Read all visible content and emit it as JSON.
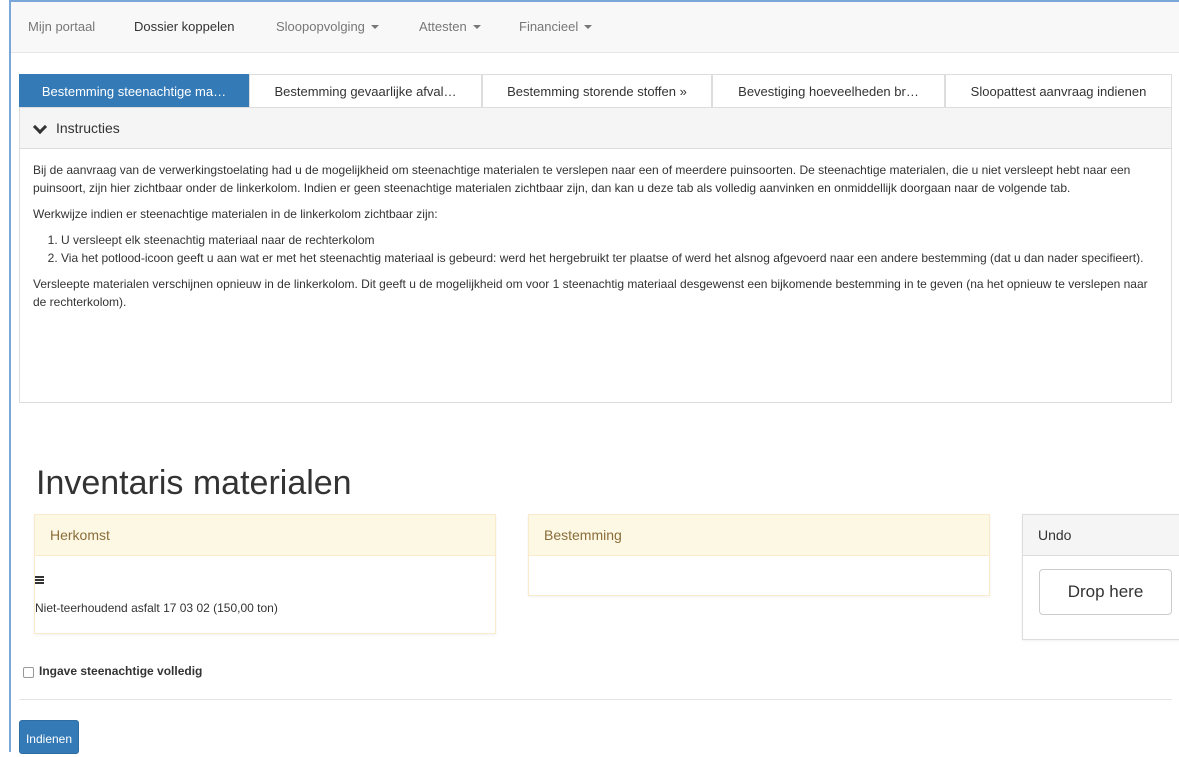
{
  "nav": {
    "items": [
      {
        "label": "Mijn portaal",
        "dropdown": false
      },
      {
        "label": "Dossier koppelen",
        "dropdown": false,
        "active": true
      },
      {
        "label": "Sloopopvolging",
        "dropdown": true
      },
      {
        "label": "Attesten",
        "dropdown": true
      },
      {
        "label": "Financieel",
        "dropdown": true
      }
    ]
  },
  "tabs": [
    {
      "label": "Bestemming steenachtige ma…",
      "active": true
    },
    {
      "label": "Bestemming gevaarlijke afval…",
      "active": false
    },
    {
      "label": "Bestemming storende stoffen »",
      "active": false
    },
    {
      "label": "Bevestiging hoeveelheden br…",
      "active": false
    },
    {
      "label": "Sloopattest aanvraag indienen",
      "active": false
    }
  ],
  "instructions": {
    "title": "Instructies",
    "paragraph1": "Bij de aanvraag van de verwerkingstoelating had u de mogelijkheid om steenachtige materialen te verslepen naar een of meerdere puinsoorten. De steenachtige materialen, die u niet versleept hebt naar een puinsoort, zijn hier zichtbaar onder de linkerkolom. Indien er geen steenachtige materialen zichtbaar zijn, dan kan u deze tab als volledig aanvinken en onmiddellijk doorgaan naar de volgende tab.",
    "paragraph2": "Werkwijze indien er steenachtige materialen in de linkerkolom zichtbaar zijn:",
    "steps": [
      "U versleept elk steenachtig materiaal naar de rechterkolom",
      "Via het potlood-icoon geeft u aan wat er met het steenachtig materiaal is gebeurd: werd het hergebruikt ter plaatse of werd het alsnog afgevoerd naar een andere bestemming (dat u dan nader specifieert)."
    ],
    "paragraph3": "Versleepte materialen verschijnen opnieuw in de linkerkolom. Dit geeft u de mogelijkheid om voor 1 steenachtig materiaal desgewenst een bijkomende bestemming in te geven (na het opnieuw te verslepen naar de rechterkolom)."
  },
  "inventory": {
    "title": "Inventaris materialen",
    "herkomst": {
      "header": "Herkomst",
      "items": [
        "Niet-teerhoudend asfalt 17 03 02 (150,00 ton)"
      ]
    },
    "bestemming": {
      "header": "Bestemming"
    },
    "undo": {
      "header": "Undo",
      "drop_label": "Drop here"
    }
  },
  "form": {
    "checkbox_label": "Ingave steenachtige volledig",
    "checkbox_checked": false,
    "submit_label": "Indienen"
  },
  "colors": {
    "primary": "#337ab7",
    "warning_header_bg": "#fcf8e3",
    "warning_header_text": "#8a6d3b"
  }
}
